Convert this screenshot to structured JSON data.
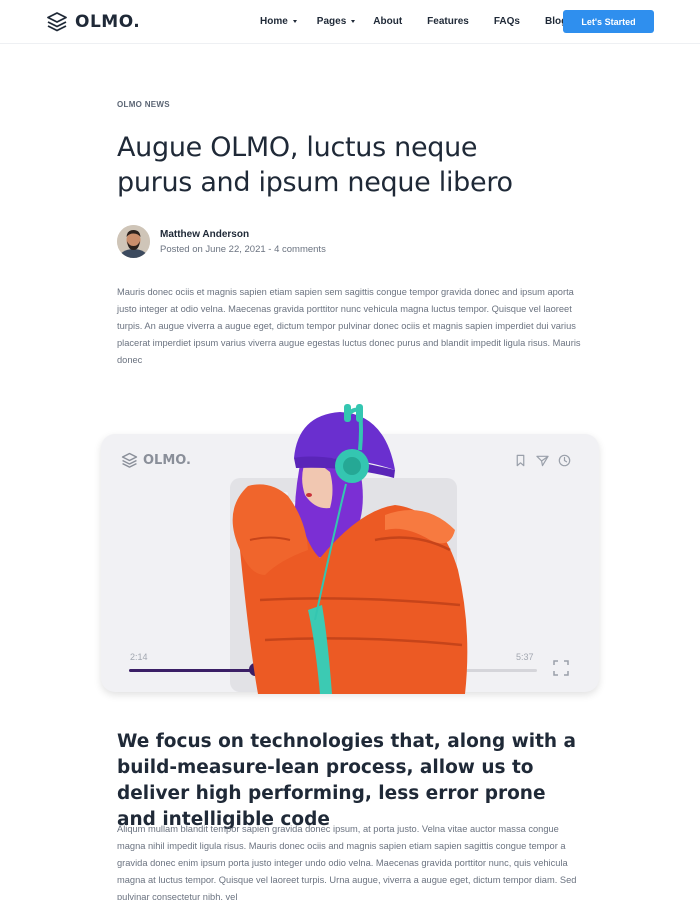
{
  "header": {
    "brand": "OLMO.",
    "nav": [
      {
        "label": "Home",
        "dropdown": true
      },
      {
        "label": "Pages",
        "dropdown": true
      },
      {
        "label": "About",
        "dropdown": false
      },
      {
        "label": "Features",
        "dropdown": false
      },
      {
        "label": "FAQs",
        "dropdown": false
      },
      {
        "label": "Blog",
        "dropdown": false
      }
    ],
    "cta_label": "Let's Started"
  },
  "article": {
    "eyebrow": "OLMO NEWS",
    "title": "Augue OLMO, luctus neque purus and ipsum neque libero",
    "author_name": "Matthew Anderson",
    "meta": "Posted on June 22, 2021 - 4 comments",
    "intro": "Mauris donec ociis et magnis sapien etiam sapien sem sagittis congue tempor gravida donec and ipsum aporta justo integer at odio velna. Maecenas gravida porttitor nunc vehicula magna luctus tempor. Quisque vel laoreet turpis. An augue viverra a augue eget, dictum tempor pulvinar donec ociis et magnis sapien imperdiet dui varius placerat imperdiet ipsum varius viverra augue egestas luctus donec purus and blandit impedit ligula risus. Mauris donec",
    "subheading": "We focus on technologies that, along with a build-measure-lean process, allow us to deliver high performing, less error prone and intelligible code",
    "body": "Aliqum mullam blandit tempor sapien gravida donec ipsum, at porta justo. Velna vitae auctor massa congue magna nihil impedit ligula risus. Mauris donec ociis and magnis sapien etiam sapien sagittis congue tempor a gravida donec enim ipsum porta justo integer undo odio velna. Maecenas gravida porttitor nunc, quis vehicula magna at luctus tempor. Quisque vel laoreet turpis. Urna augue, viverra a augue eget, dictum tempor diam. Sed pulvinar consectetur nibh, vel"
  },
  "player": {
    "brand": "OLMO.",
    "current_time": "2:14",
    "duration": "5:37",
    "progress": 0.31,
    "icons": [
      "bookmark-icon",
      "send-icon",
      "clock-icon",
      "expand-icon"
    ]
  },
  "colors": {
    "accent": "#2f8fee",
    "progress": "#3b1f66",
    "jacket": "#ec5a24",
    "beanie": "#6a2fcf",
    "headphones": "#34c6b1"
  }
}
